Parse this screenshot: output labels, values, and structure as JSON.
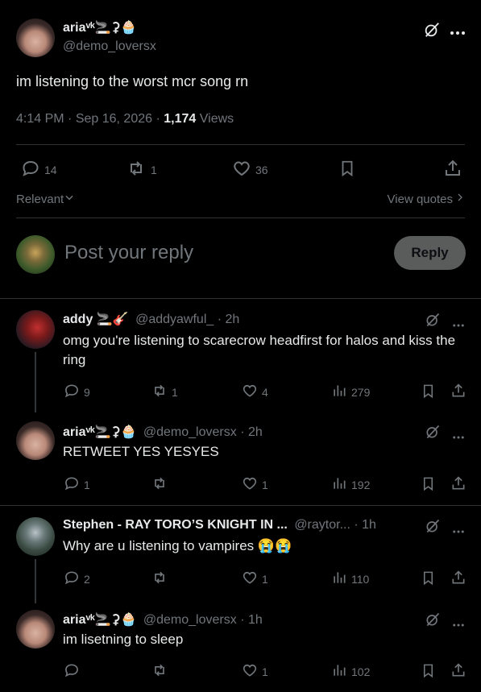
{
  "main_post": {
    "display_name": "ariaᵛᵏ🚬⚳🧁",
    "handle": "@demo_loversx",
    "text": "im listening to the worst mcr song rn",
    "time": "4:14 PM",
    "dot1": "·",
    "date": "Sep 16, 2026",
    "dot2": "·",
    "views_count": "1,174",
    "views_label": "Views",
    "replies": "14",
    "reposts": "1",
    "likes": "36"
  },
  "filters": {
    "sort_label": "Relevant",
    "view_quotes": "View quotes"
  },
  "composer": {
    "placeholder": "Post your reply",
    "button": "Reply"
  },
  "replies": [
    {
      "display_name": "addy 🚬🎸",
      "handle": "@addyawful_",
      "time": "· 2h",
      "text": "omg you're listening to scarecrow headfirst for halos and kiss the ring",
      "replies": "9",
      "reposts": "1",
      "likes": "4",
      "views": "279"
    },
    {
      "display_name": "ariaᵛᵏ🚬⚳🧁",
      "handle": "@demo_loversx",
      "time": "· 2h",
      "text": "RETWEET YES YESYES",
      "replies": "1",
      "reposts": "",
      "likes": "1",
      "views": "192"
    },
    {
      "display_name": "Stephen - RAY TORO’S KNIGHT IN ...",
      "handle": "@raytor...",
      "time": "· 1h",
      "text": "Why are u listening to vampires 😭😭",
      "replies": "2",
      "reposts": "",
      "likes": "1",
      "views": "110"
    },
    {
      "display_name": "ariaᵛᵏ🚬⚳🧁",
      "handle": "@demo_loversx",
      "time": "· 1h",
      "text": "im lisetning to sleep",
      "replies": "",
      "reposts": "",
      "likes": "1",
      "views": "102"
    }
  ],
  "colors": {
    "background": "#000000",
    "text": "#e7e9ea",
    "secondary": "#71767b",
    "divider": "#2f3336",
    "reply_button_bg": "#787a7a"
  },
  "icons": [
    "grok-icon",
    "more-icon",
    "reply-icon",
    "repost-icon",
    "like-icon",
    "bookmark-icon",
    "share-icon",
    "views-icon",
    "chevron-down-icon",
    "chevron-right-icon"
  ]
}
